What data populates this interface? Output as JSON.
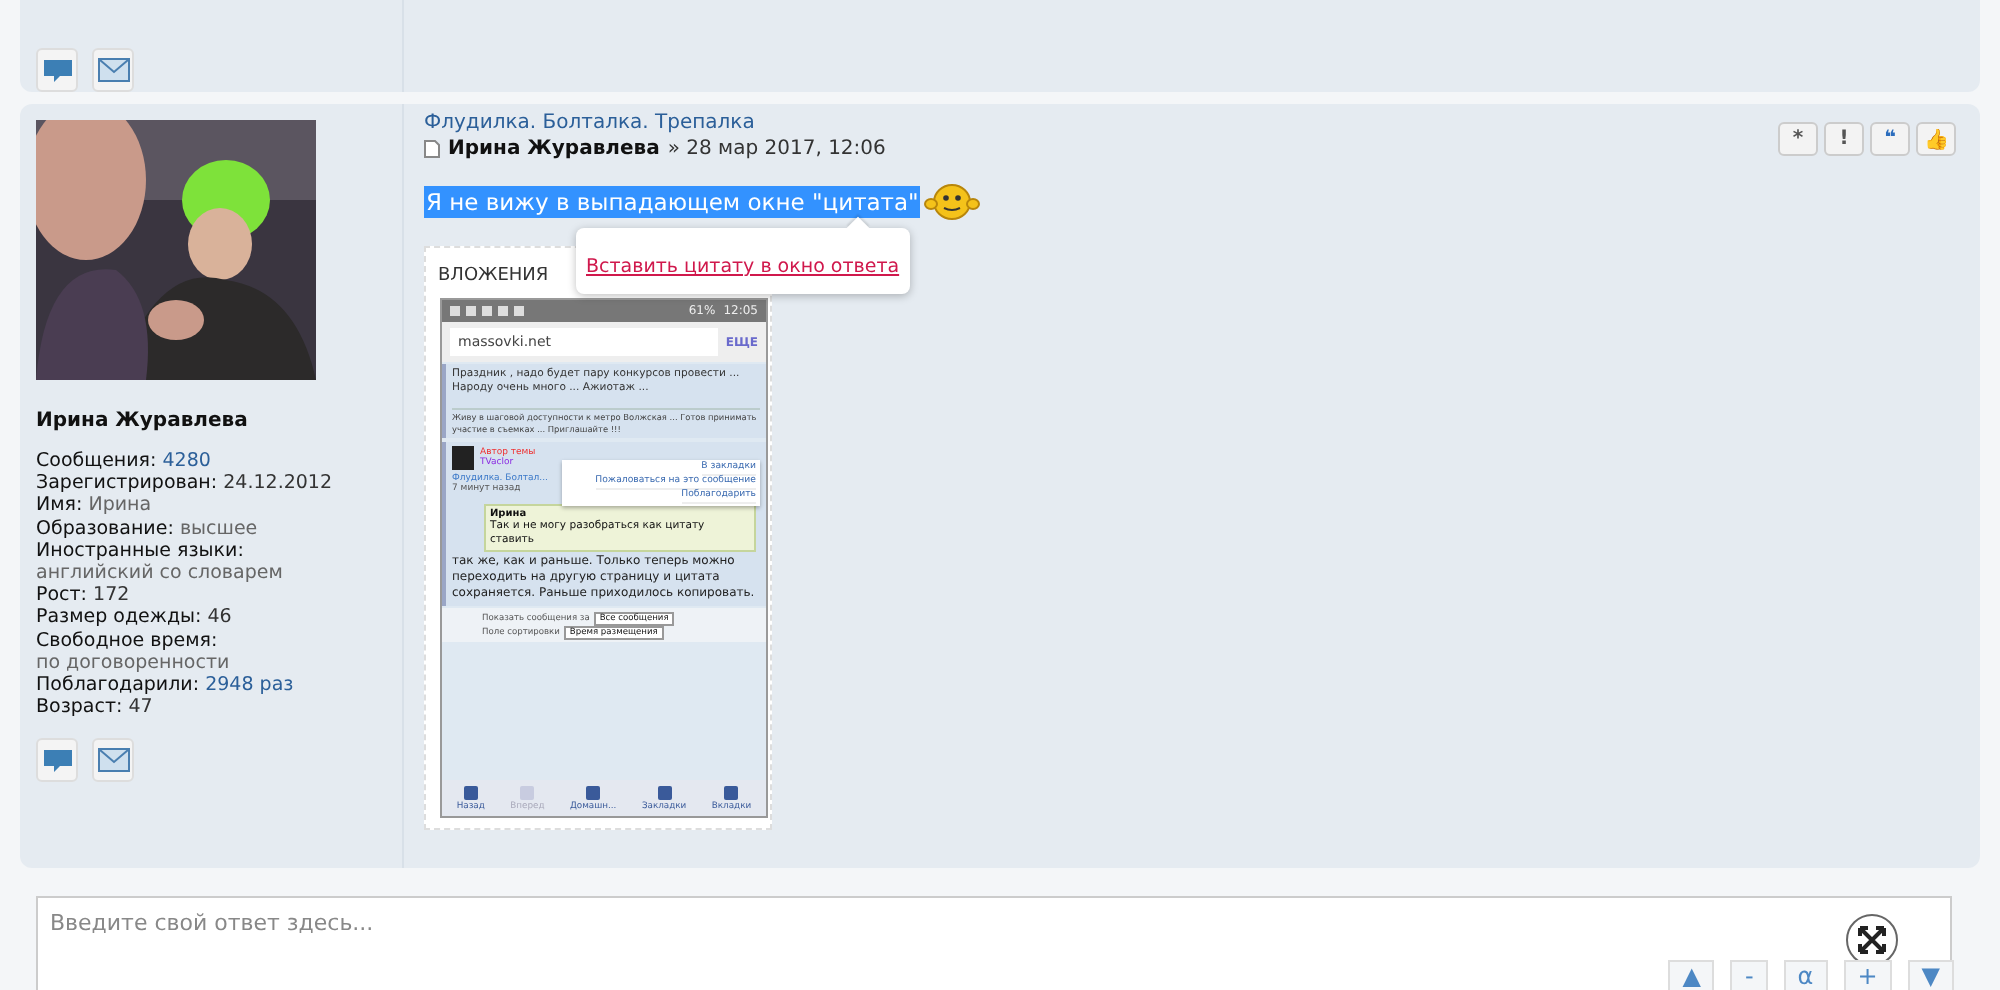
{
  "post": {
    "author": {
      "name": "Ирина Журавлева",
      "fields": [
        {
          "label": "Сообщения:",
          "value": "4280",
          "kind": "link"
        },
        {
          "label": "Зарегистрирован:",
          "value": "24.12.2012",
          "kind": "text"
        },
        {
          "label": "Имя:",
          "value": "Ирина",
          "kind": "muted"
        },
        {
          "label": "Образование:",
          "value": "высшее",
          "kind": "muted"
        },
        {
          "label": "Иностранные языки:",
          "value": "английский со словарем",
          "kind": "muted"
        },
        {
          "label": "Рост:",
          "value": "172",
          "kind": "text"
        },
        {
          "label": "Размер одежды:",
          "value": "46",
          "kind": "text"
        },
        {
          "label": "Свободное время:",
          "value": "по договоренности",
          "kind": "muted"
        },
        {
          "label": "Поблагодарили:",
          "value": "2948 раз",
          "kind": "link"
        },
        {
          "label": "Возраст:",
          "value": "47",
          "kind": "text"
        }
      ]
    },
    "forum": "Флудилка. Болталка. Трепалка",
    "byline": {
      "author": "Ирина Журавлева",
      "date": "» 28 мар 2017, 12:06"
    },
    "selected_text": "Я не вижу в выпадающем окне \"цитата\"",
    "quote_popup": "Вставить цитату в окно ответа",
    "actions": [
      {
        "label": "*",
        "kind": "star"
      },
      {
        "label": "!",
        "kind": "report"
      },
      {
        "label": "❝",
        "kind": "quote"
      },
      {
        "label": "👍",
        "kind": "thanks"
      }
    ],
    "attachments": {
      "title": "ВЛОЖЕНИЯ",
      "screenshot": {
        "status": {
          "battery": "61%",
          "time": "12:05"
        },
        "url": "massovki.net",
        "more": "ЕЩЕ",
        "post1": "Праздник , надо будет пару конкурсов провести ... Народу очень много ... Ажиотаж ...",
        "signature": "Живу в шаговой доступности к метро Волжская ... Готов принимать участие в съемках ... Приглашайте !!!",
        "author_role": "Автор темы",
        "author_name": "TVaclor",
        "crumb": "Флудилка. Болтал...",
        "time_ago": "7 минут назад",
        "menu": [
          "В закладки",
          "Пожаловаться на это сообщение",
          "Поблагодарить"
        ],
        "quote_author": "Ирина",
        "quote_text": "Так и не могу разобраться как цитату ставить",
        "post2": "так же, как и раньше. Только теперь можно переходить на другую страницу и цитата сохраняется. Раньше приходилось копировать.",
        "filters": [
          {
            "label": "Показать сообщения за",
            "value": "Все сообщения"
          },
          {
            "label": "Поле сортировки",
            "value": "Время размещения"
          }
        ],
        "nav": [
          {
            "label": "Назад",
            "disabled": false
          },
          {
            "label": "Вперед",
            "disabled": true
          },
          {
            "label": "Домашн...",
            "disabled": false
          },
          {
            "label": "Закладки",
            "disabled": false
          },
          {
            "label": "Вкладки",
            "disabled": false
          }
        ]
      }
    }
  },
  "reply": {
    "placeholder": "Введите свой ответ здесь..."
  },
  "editor_buttons": [
    "▲",
    "-",
    "α",
    "+",
    "▼"
  ]
}
